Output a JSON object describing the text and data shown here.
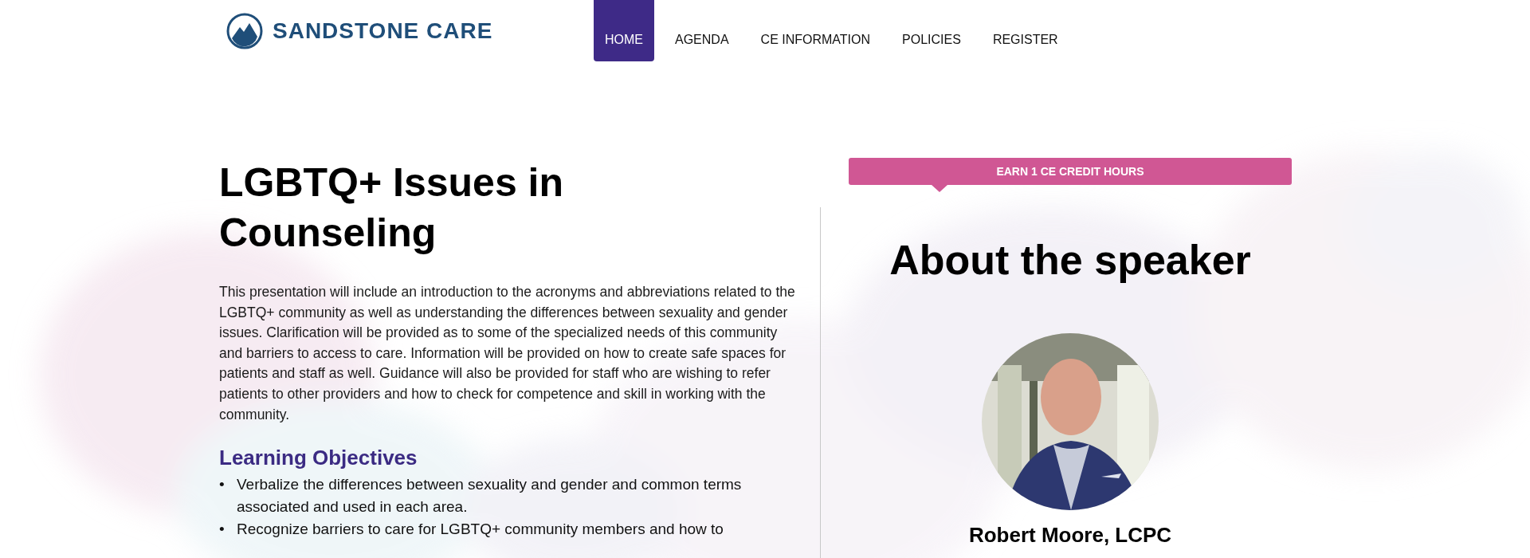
{
  "header": {
    "logo_text": "SANDSTONE CARE",
    "nav": [
      {
        "label": "HOME",
        "selected": true
      },
      {
        "label": "AGENDA",
        "selected": false
      },
      {
        "label": "CE INFORMATION",
        "selected": false
      },
      {
        "label": "POLICIES",
        "selected": false
      },
      {
        "label": "REGISTER",
        "selected": false
      }
    ]
  },
  "course": {
    "title": "LGBTQ+ Issues in Counseling",
    "description": "This presentation will include an introduction to the acronyms and abbreviations related to the LGBTQ+ community as well as understanding the differences between sexuality and gender issues. Clarification will be provided as to some of the specialized needs of this community and barriers to access to care. Information will be provided on how to create safe spaces for patients and staff as well. Guidance will also be provided for staff who are wishing to refer patients to other providers and how to check for competence and skill in working with the community.",
    "objectives_heading": "Learning Objectives",
    "objectives": [
      {
        "marker": "•",
        "text": "Verbalize the differences between sexuality and gender and common terms associated and used in each area."
      },
      {
        "marker": "•",
        "text": "Recognize barriers to care for LGBTQ+ community members and how to"
      }
    ]
  },
  "speaker": {
    "credit_badge": "EARN 1 CE CREDIT HOURS",
    "heading": "About the speaker",
    "name": "Robert Moore, LCPC"
  }
}
